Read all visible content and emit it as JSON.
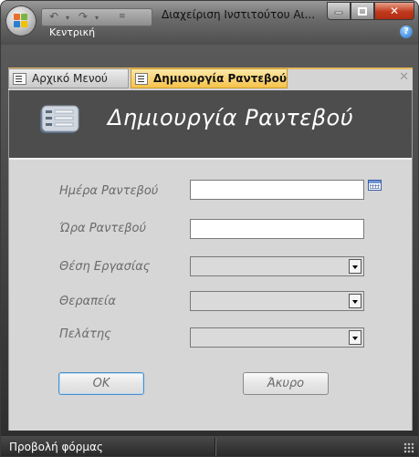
{
  "window": {
    "title": "Διαχείριση Ινστιτούτου Αι...",
    "ribbon_tab": "Κεντρική",
    "help_glyph": "?",
    "close_glyph": "✕"
  },
  "tabs": [
    {
      "label": "Αρχικό Μενού",
      "active": false
    },
    {
      "label": "Δημιουργία Ραντεβού",
      "active": true
    }
  ],
  "tab_close_glyph": "✕",
  "form": {
    "title": "Δημιουργία Ραντεβού",
    "fields": {
      "date_label": "Ημέρα Ραντεβού",
      "date_value": "",
      "time_label": "Ώρα Ραντεβού",
      "time_value": "",
      "position_label": "Θέση Εργασίας",
      "position_value": "",
      "therapy_label": "Θεραπεία",
      "therapy_value": "",
      "client_label": "Πελάτης",
      "client_value": ""
    },
    "ok_label": "OK",
    "cancel_label": "Άκυρο"
  },
  "status": {
    "text": "Προβολή φόρμας"
  },
  "colors": {
    "active_tab": "#f6c24a",
    "form_background": "#d6d6d6",
    "header_background": "#4d4d4d",
    "close_button": "#c0391c"
  }
}
